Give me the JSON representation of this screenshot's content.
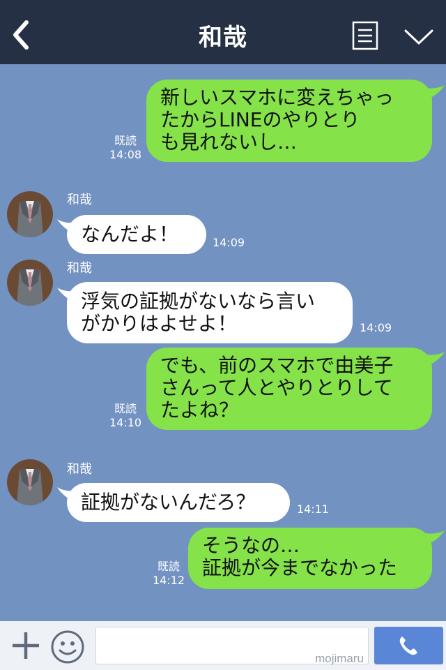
{
  "header": {
    "title": "和哉"
  },
  "chat": {
    "messages": [
      {
        "direction": "outgoing",
        "text": "新しいスマホに変えちゃっ\nたからLINEのやりとり\nも見れないし…",
        "read_label": "既読",
        "time": "14:08"
      },
      {
        "direction": "incoming",
        "sender": "和哉",
        "text": "なんだよ！",
        "time": "14:09"
      },
      {
        "direction": "incoming",
        "sender": "和哉",
        "text": "浮気の証拠がないなら言い\nがかりはよせよ！",
        "time": "14:09"
      },
      {
        "direction": "outgoing",
        "text": "でも、前のスマホで由美子\nさんって人とやりとりして\nたよね？",
        "read_label": "既読",
        "time": "14:10"
      },
      {
        "direction": "incoming",
        "sender": "和哉",
        "text": "証拠がないんだろ？",
        "time": "14:11"
      },
      {
        "direction": "outgoing",
        "text": "そうなの…\n証拠が今までなかった",
        "read_label": "既読",
        "time": "14:12"
      }
    ]
  },
  "footer": {
    "input_value": "",
    "watermark": "mojimaru"
  },
  "icons": {
    "back": "chevron-left-icon",
    "menu": "list-menu-icon",
    "collapse": "chevron-down-icon",
    "plus": "plus-icon",
    "emoji": "smiley-icon",
    "call": "phone-icon"
  },
  "colors": {
    "header_bg": "#253045",
    "chat_bg": "#7292c1",
    "outgoing_bubble": "#85e249",
    "incoming_bubble": "#ffffff",
    "call_button": "#5a86d8"
  }
}
